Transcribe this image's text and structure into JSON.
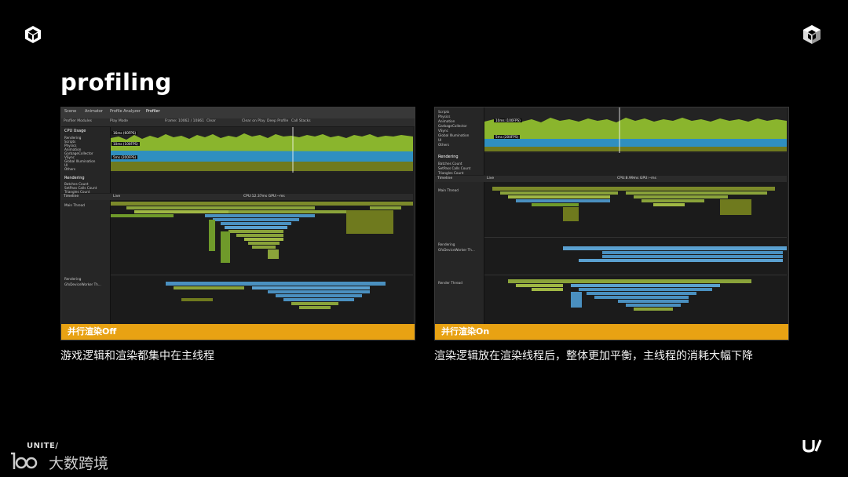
{
  "slide": {
    "title": "profiling",
    "footer_unite": "UNITE/",
    "footer_brand": "大数跨境"
  },
  "left_panel": {
    "caption": "并行渲染Off",
    "description": "游戏逻辑和渲染都集中在主线程",
    "tabs": [
      "Scene",
      "Animator",
      "Profile Analyzer",
      "Profiler"
    ],
    "toolbar_labels": [
      "Profiler Modules",
      "Play Mode",
      "Frame: 10062 / 10861",
      "Clear",
      "Clear on Play",
      "Deep Profile",
      "Call Stacks"
    ],
    "cpu_module": {
      "title": "CPU Usage",
      "items": [
        "Rendering",
        "Scripts",
        "Physics",
        "Animation",
        "GarbageCollector",
        "VSync",
        "Global Illumination",
        "UI",
        "Others"
      ]
    },
    "rendering_module": {
      "title": "Rendering",
      "items": [
        "Batches Count",
        "SetPass Calls Count",
        "Triangles Count"
      ]
    },
    "fps_tags": [
      "16ms (60FPS)",
      "10ms (100FPS)",
      "5ms (200FPS)"
    ],
    "timeline_header": "CPU:12.37ms  GPU:--ms",
    "timeline_mode": "Timeline",
    "live_label": "Live",
    "threads": [
      "Main Thread",
      "Rendering",
      "GfxDeviceWorker Th..."
    ]
  },
  "right_panel": {
    "caption": "并行渲染On",
    "description": "渲染逻辑放在渲染线程后，整体更加平衡，主线程的消耗大幅下降",
    "cpu_module": {
      "items": [
        "Scripts",
        "Physics",
        "Animation",
        "GarbageCollector",
        "VSync",
        "Global Illumination",
        "UI",
        "Others"
      ]
    },
    "rendering_module": {
      "title": "Rendering",
      "items": [
        "Batches Count",
        "SetPass Calls Count",
        "Triangles Count"
      ]
    },
    "fps_tags": [
      "10ms (100FPS)",
      "5ms (200FPS)"
    ],
    "timeline_header": "CPU:8.99ms  GPU:--ms",
    "timeline_mode": "Timeline",
    "live_label": "Live",
    "threads": [
      "Main Thread",
      "Rendering",
      "GfxDeviceWorker Th...",
      "Render Thread"
    ]
  },
  "colors": {
    "caption_bar": "#e8a213",
    "cpu_green": "#8ab52d",
    "cpu_blue": "#2f8fc0",
    "cpu_olive": "#6f7a1e",
    "timeline_blue": "#4a90c0",
    "timeline_green": "#8aa33a"
  }
}
